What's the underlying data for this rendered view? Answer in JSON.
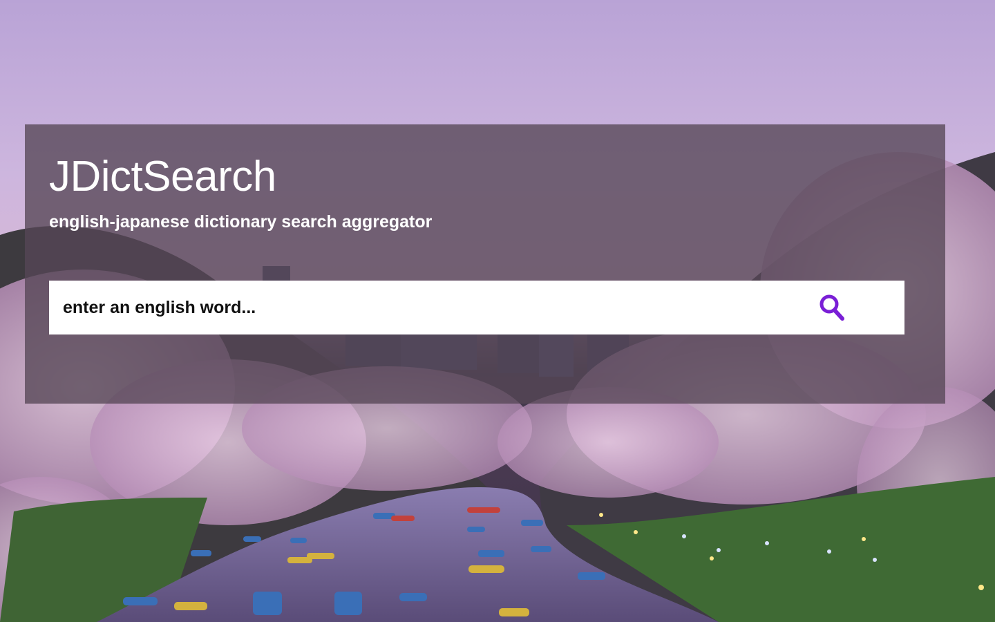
{
  "app": {
    "title": "JDictSearch",
    "subtitle": "english-japanese dictionary search aggregator"
  },
  "search": {
    "placeholder": "enter an english word...",
    "value": "",
    "icon": "search-icon"
  },
  "colors": {
    "accent": "#7a1fd6",
    "panel_overlay": "#564656",
    "text": "#ffffff"
  },
  "background": {
    "image": "cherry-blossom-river-scene"
  }
}
